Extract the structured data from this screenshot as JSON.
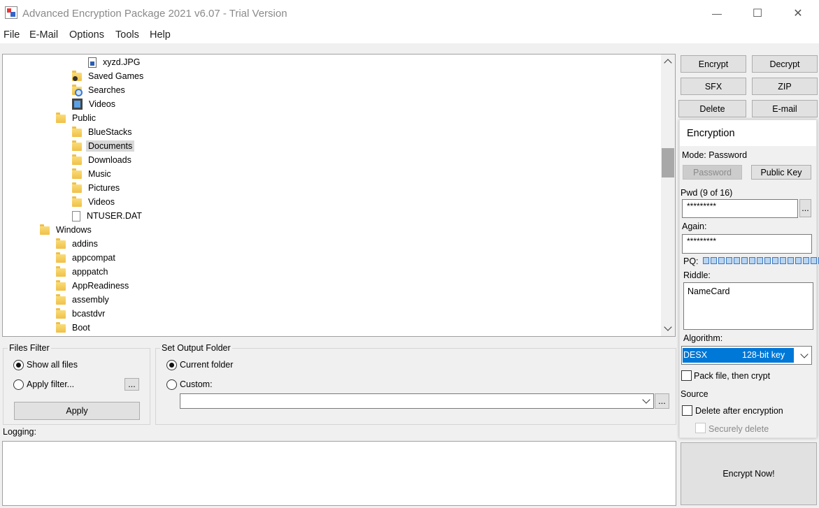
{
  "window": {
    "title": "Advanced Encryption Package 2021 v6.07 - Trial Version",
    "controls": {
      "minimize": "—",
      "maximize": "☐",
      "close": "✕"
    }
  },
  "menu": [
    "File",
    "E-Mail",
    "Options",
    "Tools",
    "Help"
  ],
  "tree": {
    "items": [
      {
        "label": "xyzd.JPG",
        "icon": "jpg-file-icon"
      },
      {
        "label": "Saved Games",
        "icon": "saved-games-folder-icon"
      },
      {
        "label": "Searches",
        "icon": "searches-folder-icon"
      },
      {
        "label": "Videos",
        "icon": "videos-folder-icon"
      },
      {
        "label": "Public",
        "icon": "folder-icon"
      },
      {
        "label": "BlueStacks",
        "icon": "folder-icon"
      },
      {
        "label": "Documents",
        "icon": "folder-icon",
        "selected": true
      },
      {
        "label": "Downloads",
        "icon": "folder-icon"
      },
      {
        "label": "Music",
        "icon": "folder-icon"
      },
      {
        "label": "Pictures",
        "icon": "folder-icon"
      },
      {
        "label": "Videos",
        "icon": "folder-icon"
      },
      {
        "label": "NTUSER.DAT",
        "icon": "file-icon"
      },
      {
        "label": "Windows",
        "icon": "folder-icon"
      },
      {
        "label": "addins",
        "icon": "folder-icon"
      },
      {
        "label": "appcompat",
        "icon": "folder-icon"
      },
      {
        "label": "apppatch",
        "icon": "folder-icon"
      },
      {
        "label": "AppReadiness",
        "icon": "folder-icon"
      },
      {
        "label": "assembly",
        "icon": "folder-icon"
      },
      {
        "label": "bcastdvr",
        "icon": "folder-icon"
      },
      {
        "label": "Boot",
        "icon": "folder-icon"
      }
    ]
  },
  "files_filter": {
    "title": "Files Filter",
    "show_all": "Show all files",
    "apply_filter": "Apply filter...",
    "browse": "...",
    "apply_button": "Apply"
  },
  "output_folder": {
    "title": "Set Output Folder",
    "current_folder": "Current folder",
    "custom": "Custom:",
    "custom_value": "",
    "browse": "..."
  },
  "logging": {
    "label": "Logging:",
    "content": ""
  },
  "actions": {
    "encrypt": "Encrypt",
    "decrypt": "Decrypt",
    "sfx": "SFX",
    "zip": "ZIP",
    "delete": "Delete",
    "email": "E-mail"
  },
  "encryption": {
    "title": "Encryption",
    "mode": "Mode: Password",
    "password_button": "Password",
    "public_key_button": "Public Key",
    "pwd_label": "Pwd (9 of 16)",
    "pwd_value": "*********",
    "pwd_browse": "...",
    "again_label": "Again:",
    "again_value": "*********",
    "pq_label": "PQ:",
    "pq_total": 16,
    "riddle_label": "Riddle:",
    "riddle_value": "NameCard",
    "algorithm_label": "Algorithm:",
    "algorithm_name": "DESX",
    "algorithm_key": "128-bit key",
    "pack_label": "Pack file, then crypt",
    "source_label": "Source",
    "delete_after_label": "Delete after encryption",
    "securely_delete_label": "Securely delete",
    "encrypt_now": "Encrypt Now!"
  },
  "colors": {
    "selection_blue": "#0078d7",
    "pq_blue": "#3a78c3"
  }
}
